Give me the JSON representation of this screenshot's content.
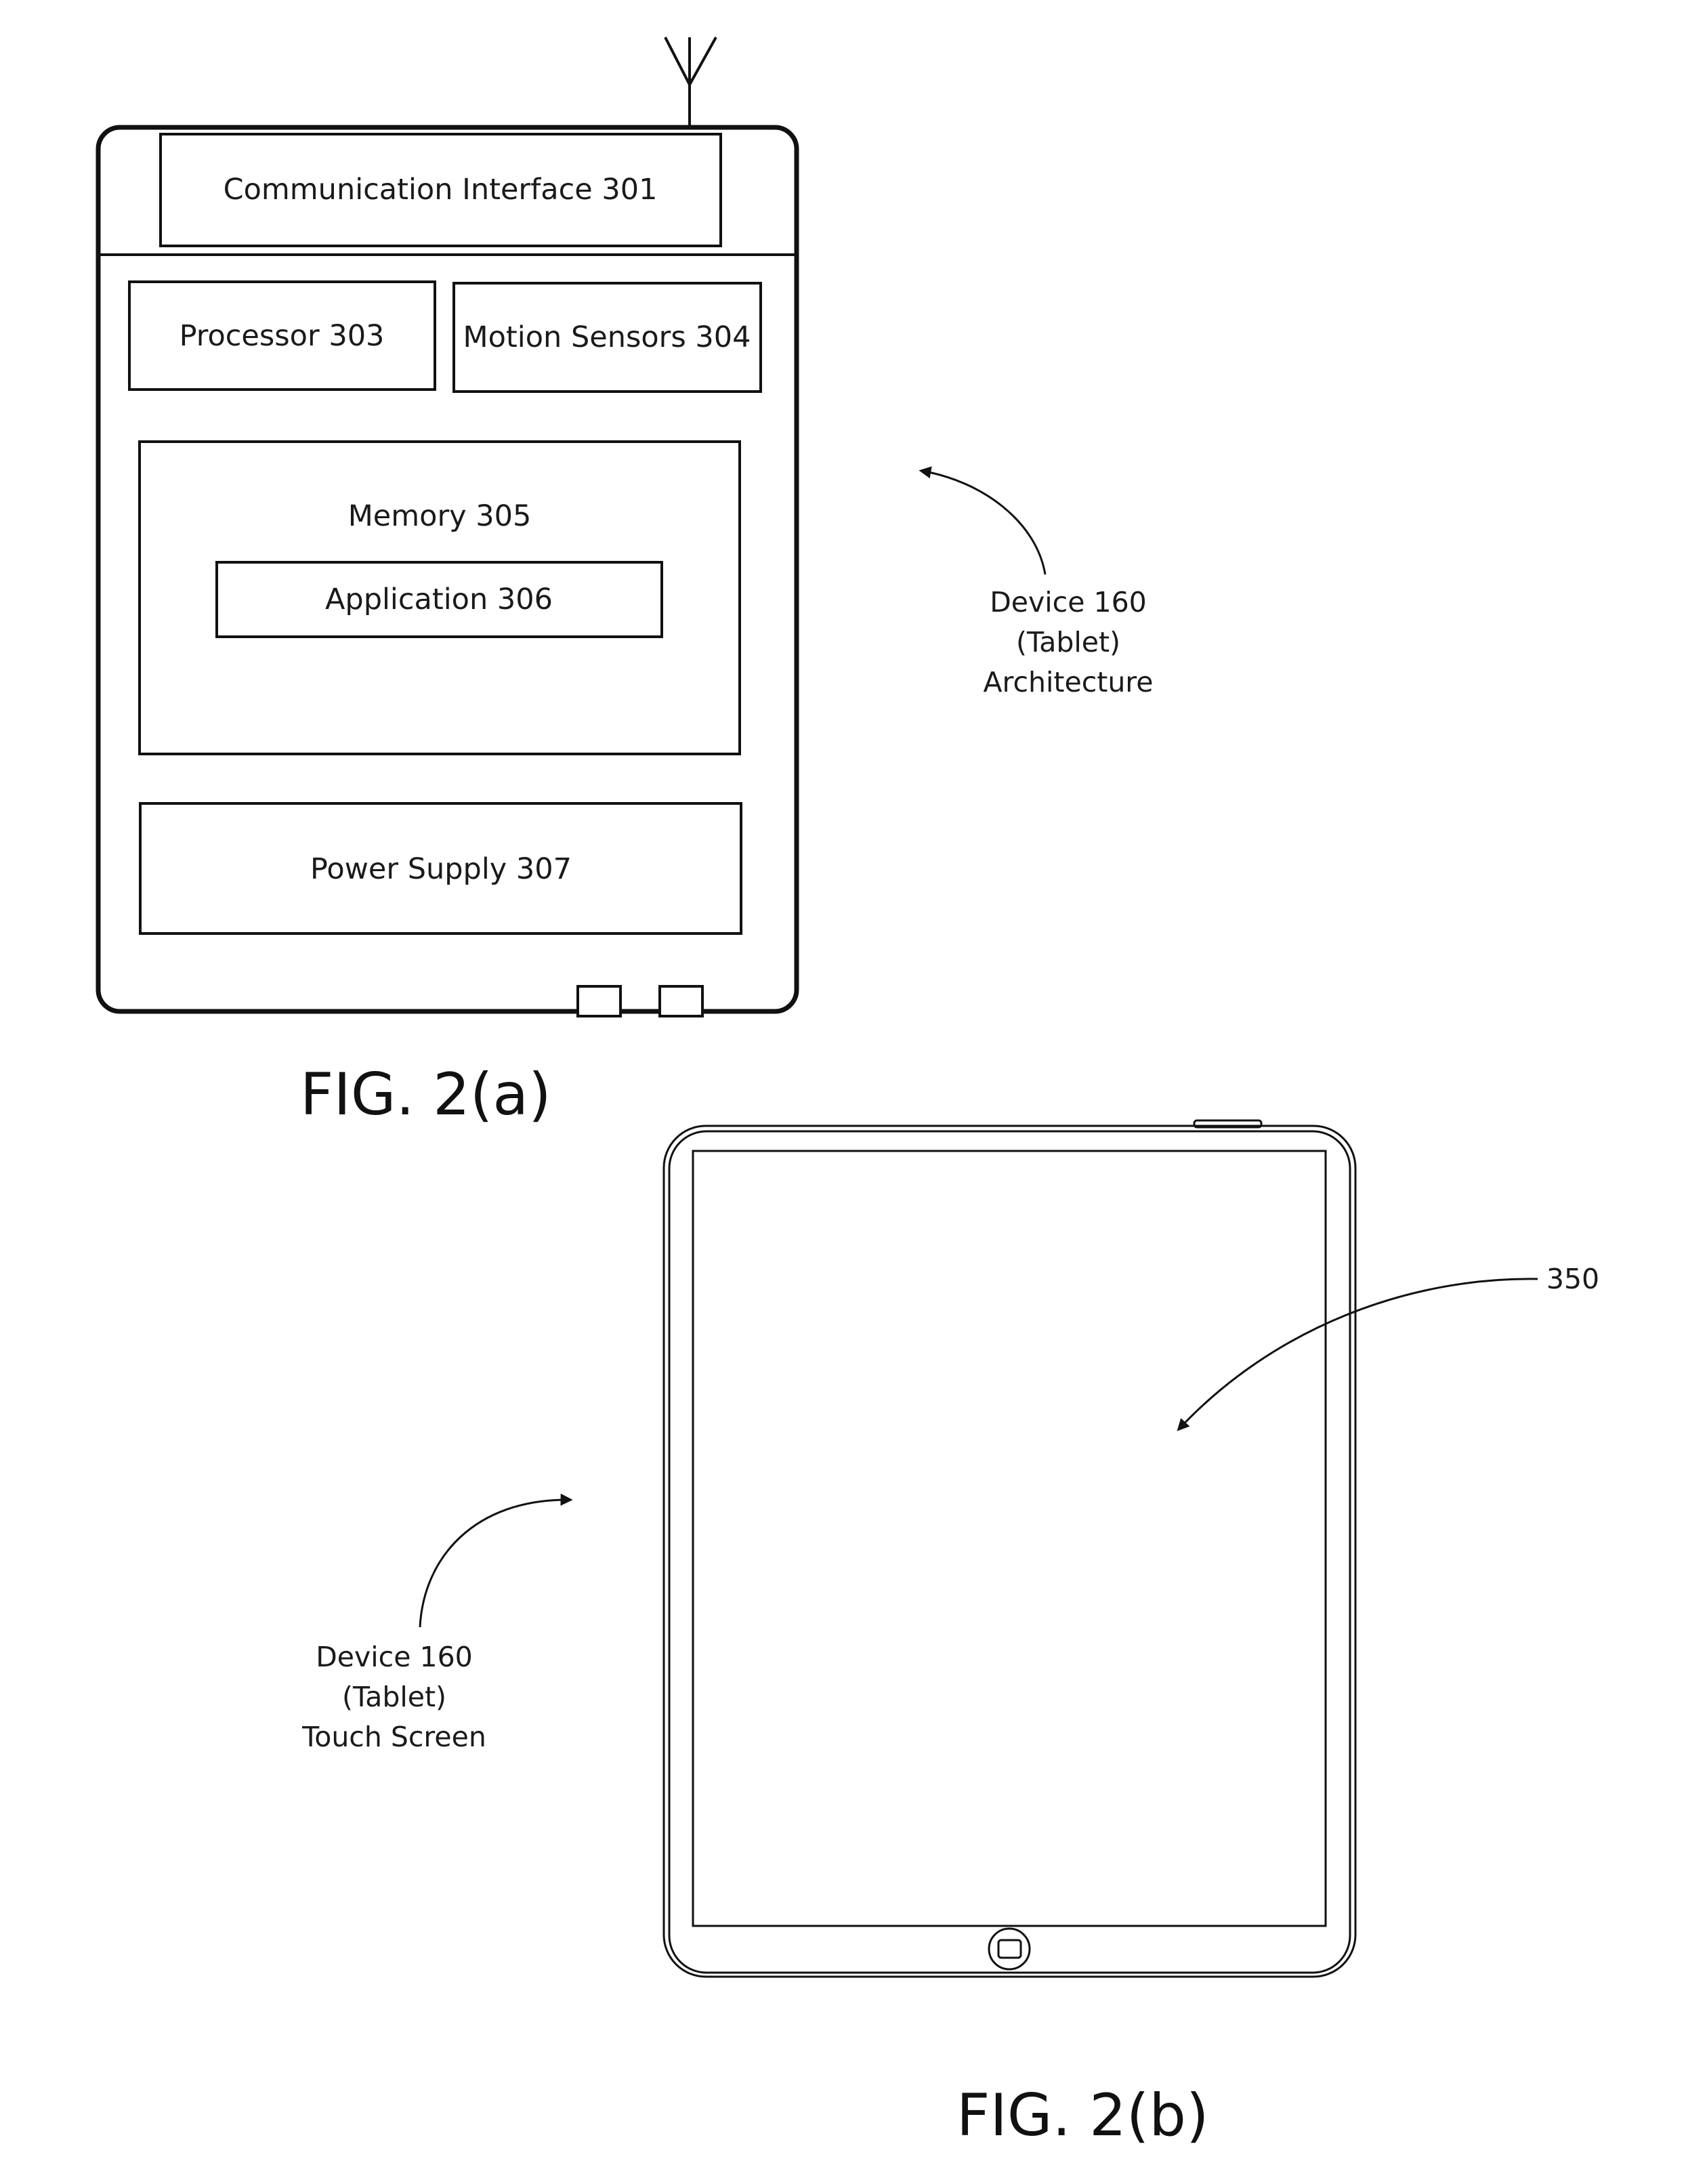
{
  "figure_a": {
    "caption": "FIG. 2(a)",
    "components": {
      "communication_interface": "Communication Interface 301",
      "processor": "Processor 303",
      "motion_sensors": "Motion Sensors 304",
      "memory": "Memory 305",
      "application": "Application 306",
      "power_supply": "Power Supply 307"
    },
    "callout": {
      "line1": "Device 160",
      "line2": "(Tablet)",
      "line3": "Architecture"
    }
  },
  "figure_b": {
    "caption": "FIG. 2(b)",
    "screen_reference": "350",
    "callout": {
      "line1": "Device 160",
      "line2": "(Tablet)",
      "line3": "Touch Screen"
    }
  },
  "colors": {
    "line": "#111111",
    "background": "#ffffff"
  }
}
